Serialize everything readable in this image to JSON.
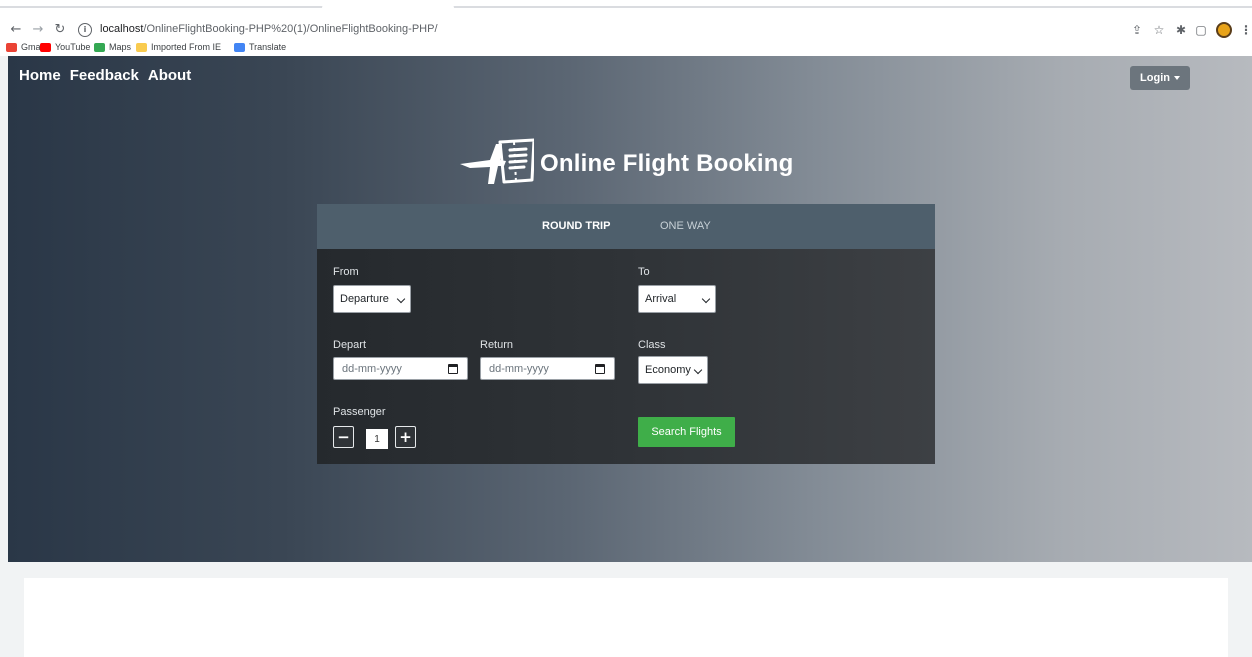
{
  "browser": {
    "url_host": "localhost",
    "url_path": "/OnlineFlightBooking-PHP%20(1)/OnlineFlightBooking-PHP/",
    "bookmarks": [
      {
        "label": "Gmail",
        "color": "#ea4335"
      },
      {
        "label": "YouTube",
        "color": "#ff0000"
      },
      {
        "label": "Maps",
        "color": "#34a853"
      },
      {
        "label": "Imported From IE",
        "color": "#f9cb4f"
      },
      {
        "label": "Translate",
        "color": "#4285f4"
      }
    ]
  },
  "nav": {
    "links": [
      "Home",
      "Feedback",
      "About"
    ],
    "login_label": "Login"
  },
  "brand": {
    "title": "Online Flight Booking"
  },
  "booking": {
    "tabs": {
      "round_trip": "ROUND TRIP",
      "one_way": "ONE WAY"
    },
    "from": {
      "label": "From",
      "value": "Departure"
    },
    "to": {
      "label": "To",
      "value": "Arrival"
    },
    "depart": {
      "label": "Depart",
      "placeholder": "dd-mm-yyyy"
    },
    "return": {
      "label": "Return",
      "placeholder": "dd-mm-yyyy"
    },
    "class": {
      "label": "Class",
      "value": "Economy"
    },
    "passenger": {
      "label": "Passenger",
      "value": "1",
      "minus": "−",
      "plus": "+"
    },
    "search_label": "Search Flights"
  },
  "colors": {
    "search_button": "#3fae49",
    "tabs_bar": "#4e5f6c",
    "login_button": "#6c757d"
  }
}
